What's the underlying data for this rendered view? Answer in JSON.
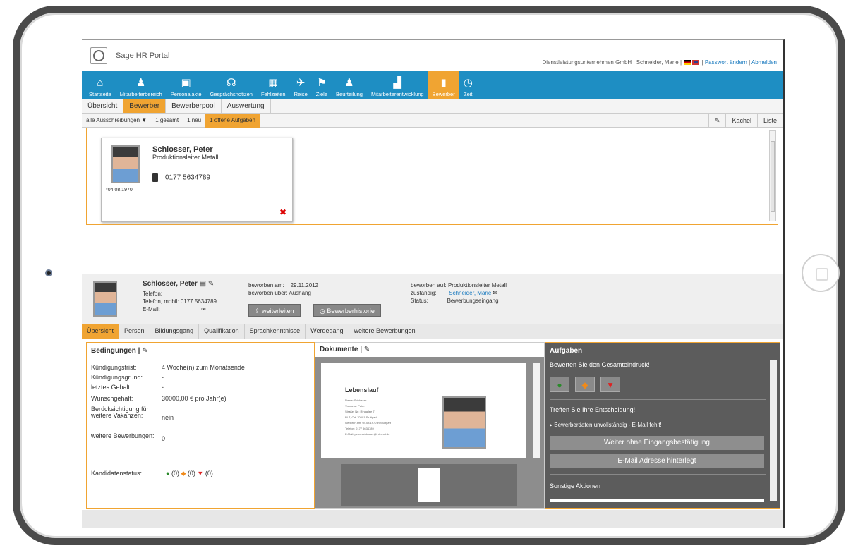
{
  "header": {
    "brand": "Sage HR Portal",
    "company_user": "Dienstleistungsunternehmen GmbH | Schneider, Marie |",
    "change_password": "Passwort ändern",
    "logout": "Abmelden",
    "separator": "|"
  },
  "nav": {
    "items": [
      {
        "label": "Startseite",
        "icon": "⌂"
      },
      {
        "label": "Mitarbeiterbereich",
        "icon": "♟"
      },
      {
        "label": "Personalakte",
        "icon": "▣"
      },
      {
        "label": "Gesprächsnotizen",
        "icon": "☊"
      },
      {
        "label": "Fehlzeiten",
        "icon": "▦"
      },
      {
        "label": "Reise",
        "icon": "✈"
      },
      {
        "label": "Ziele",
        "icon": "⚑"
      },
      {
        "label": "Beurteilung",
        "icon": "♟"
      },
      {
        "label": "Mitarbeiterentwicklung",
        "icon": "▟"
      },
      {
        "label": "Bewerber",
        "icon": "▮"
      },
      {
        "label": "Zeit",
        "icon": "◷"
      }
    ]
  },
  "tabs_top": [
    "Übersicht",
    "Bewerber",
    "Bewerberpool",
    "Auswertung"
  ],
  "filter_bar": {
    "filter": "alle Ausschreibungen ▼",
    "total": "1 gesamt",
    "new": "1 neu",
    "open_tasks": "1 offene Aufgaben",
    "tile": "Kachel",
    "list": "Liste"
  },
  "card": {
    "name": "Schlosser, Peter",
    "position": "Produktionsleiter Metall",
    "phone": "0177 5634789",
    "dob": "*04.08.1970"
  },
  "detail": {
    "name": "Schlosser, Peter",
    "phone_label": "Telefon:",
    "mobile_label": "Telefon, mobil:",
    "mobile": "0177 5634789",
    "email_label": "E-Mail:",
    "applied_on_label": "beworben am:",
    "applied_on": "29.11.2012",
    "applied_via_label": "beworben über:",
    "applied_via": "Aushang",
    "applied_for_label": "beworben auf:",
    "applied_for": "Produktionsleiter Metall",
    "responsible_label": "zuständig:",
    "responsible": "Schneider, Marie",
    "status_label": "Status:",
    "status": "Bewerbungseingang",
    "forward": "weiterleiten",
    "history": "Bewerberhistorie"
  },
  "tabs_detail": [
    "Übersicht",
    "Person",
    "Bildungsgang",
    "Qualifikation",
    "Sprachkenntnisse",
    "Werdegang",
    "weitere Bewerbungen"
  ],
  "conditions": {
    "title": "Bedingungen",
    "notice_label": "Kündigungsfrist:",
    "notice": "4 Woche(n) zum Monatsende",
    "reason_label": "Kündigungsgrund:",
    "reason": "-",
    "last_salary_label": "letztes Gehalt:",
    "last_salary": "-",
    "desired_label": "Wunschgehalt:",
    "desired": "30000,00 € pro Jahr(e)",
    "consider_label": "Berücksichtigung für weitere Vakanzen:",
    "consider": "nein",
    "more_label": "weitere Bewerbungen:",
    "more": "0",
    "status_label": "Kandidatenstatus:",
    "count_good": "(0)",
    "count_mid": "(0)",
    "count_bad": "(0)"
  },
  "documents": {
    "title": "Dokumente",
    "doc_title": "Lebenslauf",
    "doc_lines": [
      "Name:  Schlosser",
      "Vorname:  Peter",
      "Straße, Nr.:  Ringallee 7",
      "PLZ, Ort:  70001 Stuttgart",
      "Geboren am:  04.08.1970 in Stuttgart",
      "Telefon:  0177 5634789",
      "E-Mail:  peter.schlosser@internet.de"
    ]
  },
  "tasks": {
    "title": "Aufgaben",
    "rate_prompt": "Bewerten Sie den Gesamteindruck!",
    "decide_prompt": "Treffen Sie Ihre Entscheidung!",
    "warning": "Bewerberdaten unvollständig - E-Mail fehlt!",
    "btn_continue": "Weiter ohne Eingangsbestätigung",
    "btn_email": "E-Mail Adresse hinterlegt",
    "other_actions": "Sonstige Aktionen"
  },
  "colors": {
    "nav_blue": "#1e8ec3",
    "accent_orange": "#f0a432"
  }
}
